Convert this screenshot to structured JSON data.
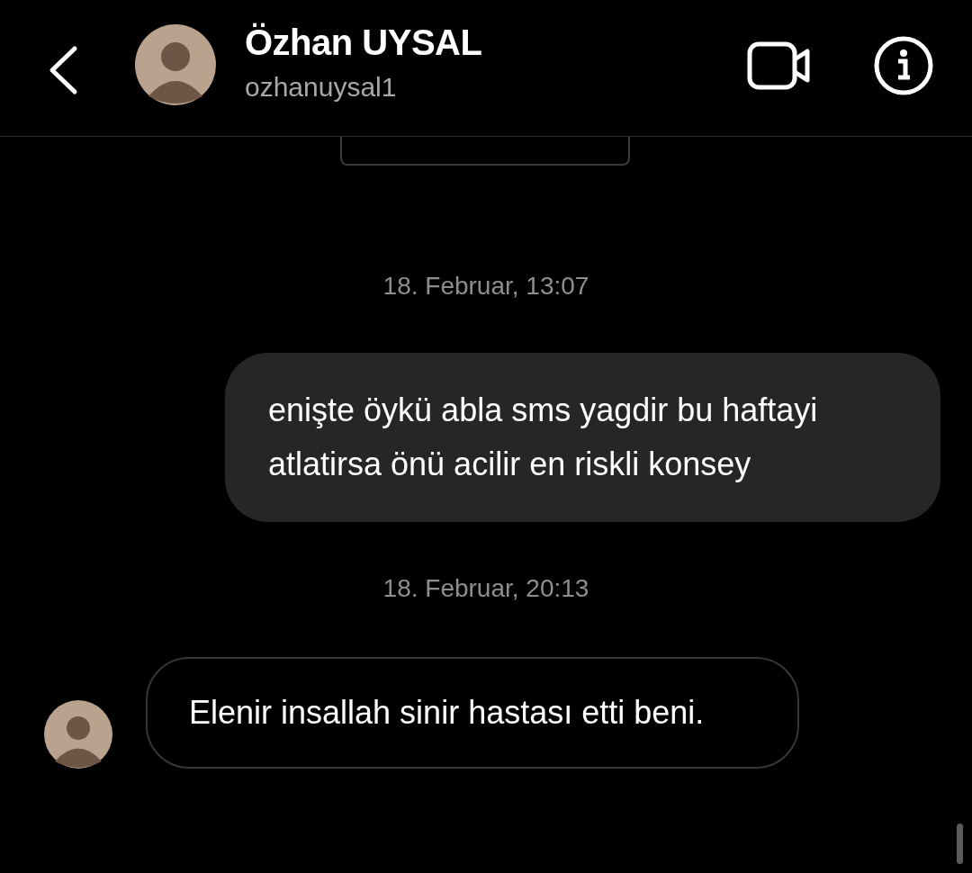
{
  "header": {
    "name": "Özhan UYSAL",
    "username": "ozhanuysal1"
  },
  "messages": [
    {
      "kind": "timestamp",
      "text": "18. Februar, 13:07"
    },
    {
      "kind": "outgoing",
      "text": "enişte öykü abla sms yagdir bu haftayi atlatirsa önü acilir en riskli konsey"
    },
    {
      "kind": "timestamp",
      "text": "18. Februar, 20:13"
    },
    {
      "kind": "incoming",
      "text": "Elenir insallah sinir hastası etti beni."
    }
  ]
}
